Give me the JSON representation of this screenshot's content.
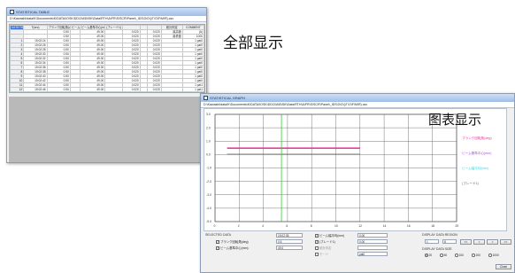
{
  "table_window": {
    "title": "STATISTICAL TABLE",
    "path": "D:\\Kawashi\\data\\K\\Documents\\K\\DATA\\IOSK\\DD\\2\\A\\B\\SK\\Data\\RTH\\A\\FR\\S\\SCR\\Panel\\_IDS\\3\\O\\(\\T\\O\\F\\M\\R).csv",
    "headers": [
      "DATE/TIME",
      "T(sec)",
      "ブランク回転角(deg)",
      "ビーム基準中心Y",
      "ビーム基準中心(mm)",
      "(ブレード1)",
      "",
      "",
      "",
      "統計判定",
      "COMMENT"
    ],
    "subheaders": [
      "",
      "",
      "0.50",
      "",
      "49.00",
      "",
      "0.020",
      "",
      "0.020",
      "最高値",
      "(A)"
    ],
    "subheaders2": [
      "",
      "",
      "0.50",
      "",
      "49.00",
      "",
      "0.020",
      "",
      "0.020",
      "最低値",
      "1000"
    ],
    "rows": [
      [
        "1",
        "15:02:24",
        "0.50",
        "",
        "49.00",
        "",
        "0.020",
        "",
        "0.020",
        "",
        "1 pat0"
      ],
      [
        "2",
        "15:02:26",
        "0.50",
        "",
        "49.00",
        "",
        "0.020",
        "",
        "0.020",
        "",
        "1 pat0"
      ],
      [
        "3",
        "15:02:28",
        "0.50",
        "",
        "49.00",
        "",
        "0.020",
        "",
        "0.020",
        "",
        "1 pat0"
      ],
      [
        "4",
        "15:02:30",
        "0.50",
        "",
        "49.00",
        "",
        "0.020",
        "",
        "0.020",
        "",
        "1 pat0"
      ],
      [
        "5",
        "15:02:32",
        "0.50",
        "",
        "49.00",
        "",
        "0.020",
        "",
        "0.020",
        "",
        "1 pat0"
      ],
      [
        "6",
        "15:02:34",
        "0.50",
        "",
        "49.00",
        "",
        "0.020",
        "",
        "0.020",
        "",
        "1 pat0"
      ],
      [
        "7",
        "15:02:36",
        "0.50",
        "",
        "49.00",
        "",
        "0.020",
        "",
        "0.020",
        "",
        "1 pat0"
      ],
      [
        "8",
        "15:02:38",
        "0.50",
        "",
        "49.00",
        "",
        "0.020",
        "",
        "0.020",
        "",
        "1 pat0"
      ],
      [
        "9",
        "15:02:40",
        "0.50",
        "",
        "49.00",
        "",
        "0.020",
        "",
        "0.020",
        "",
        "1 pat0"
      ],
      [
        "10",
        "15:02:42",
        "0.50",
        "",
        "49.00",
        "",
        "0.020",
        "",
        "0.020",
        "",
        "1 pat0"
      ],
      [
        "11",
        "15:02:44",
        "0.50",
        "",
        "49.00",
        "",
        "0.020",
        "",
        "0.020",
        "",
        "1 pat1"
      ],
      [
        "12",
        "15:02:46",
        "0.50",
        "",
        "49.00",
        "",
        "0.020",
        "",
        "0.020",
        "",
        "1 pat1"
      ]
    ]
  },
  "label_full": "全部显示",
  "label_chart": "图表显示",
  "chart_window": {
    "title": "STATISTICAL GRAPH",
    "path": "D:\\Kawashi\\data\\K\\Documents\\K\\DATA\\IOSK\\DD\\2\\A\\B\\SK\\Data\\RTH\\A\\FR\\S\\SCR\\Panel\\_IDS\\3\\O\\(\\T\\O\\F\\M\\R).csv",
    "selected_data_label": "SELECTED DATA",
    "display_region_label": "DISPLAY DATA REGION",
    "display_size_label": "DISPLAY DATA SIZE",
    "date_value": "15:02:35",
    "check_items": [
      {
        "label": "ブランク回転角(deg)",
        "value": "0.5",
        "checked": true
      },
      {
        "label": "ビーム基準中心(mm)",
        "value": "49.0",
        "checked": true
      },
      {
        "label": "ビーム幅平均(mm)",
        "value": "0.00",
        "checked": true
      },
      {
        "label": "(ブレード1)",
        "value": "0.00",
        "checked": true
      },
      {
        "label": "統計判定",
        "value": "",
        "checked": false
      },
      {
        "label": "モード",
        "value": "pat0",
        "checked": false
      }
    ],
    "region_from": "1",
    "region_to": "8",
    "buttons": [
      "<<",
      "<",
      ">",
      ">>"
    ],
    "size_options": [
      "20",
      "50",
      "100",
      "200",
      "1000"
    ],
    "close_label": "Close"
  },
  "chart_data": {
    "type": "line",
    "x_ticks": [
      "0",
      "2",
      "4",
      "6",
      "8",
      "10",
      "12",
      "14",
      "16",
      "18",
      "20"
    ],
    "y_ticks": [
      "3.0",
      "2.0",
      "1.0",
      "0.0",
      "-1.0",
      "-2.0",
      "-3.0",
      "-4.0",
      "-5.0"
    ],
    "xlim": [
      0,
      20
    ],
    "ylim": [
      -5,
      3
    ],
    "series": [
      {
        "name": "ブランク回転角(deg)",
        "color": "#e5339a",
        "x": [
          1,
          12
        ],
        "y": [
          0.5,
          0.5
        ]
      },
      {
        "name": "ビーム基準中心(mm)",
        "color": "#a04de0",
        "x": [
          1,
          12
        ],
        "y": [
          0.45,
          0.45
        ]
      },
      {
        "name": "ビーム幅平均(mm)",
        "color": "#2fd6e0",
        "x": [
          1,
          12
        ],
        "y": [
          0.02,
          0.02
        ]
      },
      {
        "name": "(ブレード1)",
        "color": "#666666",
        "x": [
          1,
          12
        ],
        "y": [
          0.02,
          0.02
        ]
      }
    ],
    "marker_x": 5.5,
    "marker_color": "#37c837",
    "grid": true,
    "legend_position": "right"
  }
}
